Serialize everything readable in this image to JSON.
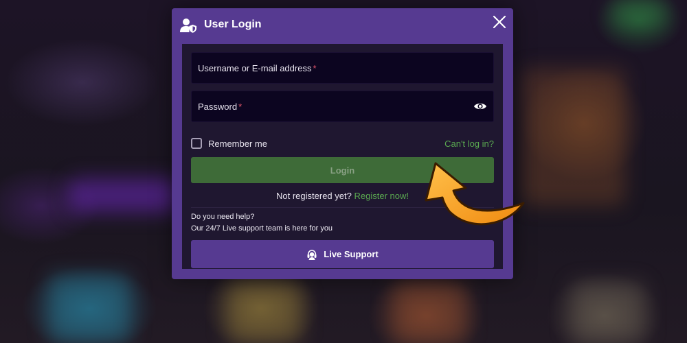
{
  "modal": {
    "title": "User Login",
    "header_icon": "user-shield-icon",
    "close_icon": "close-icon"
  },
  "form": {
    "username_label": "Username or E-mail address",
    "password_label": "Password",
    "required_mark": "*",
    "eye_icon": "eye-icon",
    "remember_label": "Remember me",
    "remember_checked": false,
    "cant_login": "Can't log in?",
    "login_label": "Login",
    "not_registered": "Not registered yet?",
    "register_link": "Register now!"
  },
  "help": {
    "line1": "Do you need help?",
    "line2": "Our 24/7 Live support team is here for you",
    "support_label": "Live Support",
    "support_icon": "headset-icon"
  },
  "colors": {
    "modal_purple": "#563a91",
    "body_dark": "#1f1730",
    "field_dark": "#0c0520",
    "login_green": "#3e6b38",
    "link_green": "#5aa850",
    "required_red": "#e0556a",
    "arrow_orange": "#f29a1e"
  }
}
